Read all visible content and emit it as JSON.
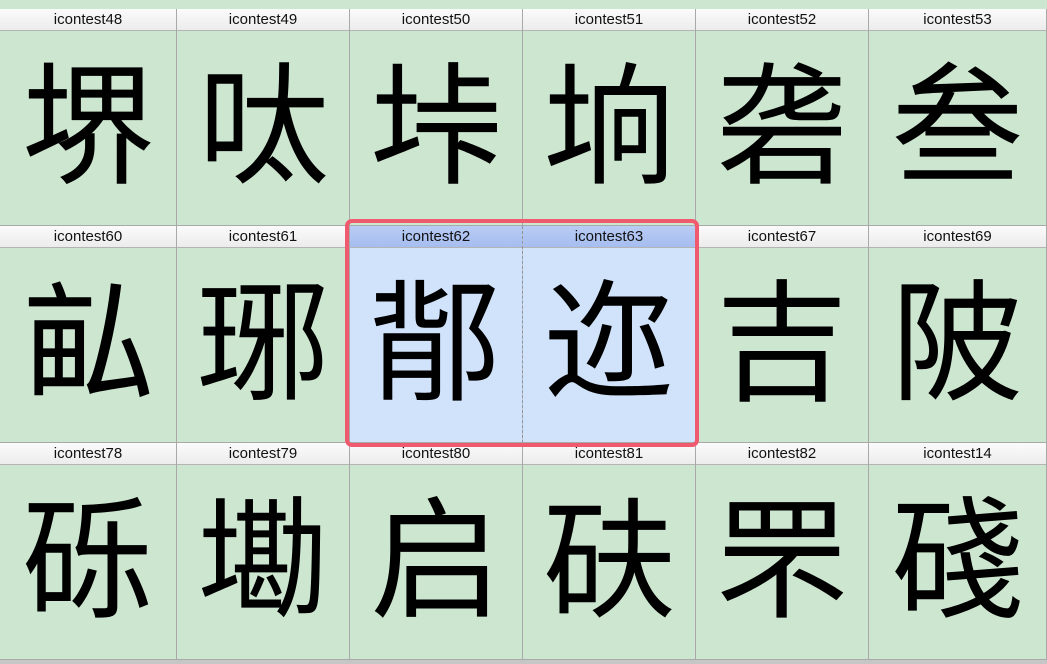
{
  "grid": {
    "rows": [
      {
        "cells": [
          {
            "label": "icontest48",
            "glyph": "堺"
          },
          {
            "label": "icontest49",
            "glyph": "呔"
          },
          {
            "label": "icontest50",
            "glyph": "垰"
          },
          {
            "label": "icontest51",
            "glyph": "垧"
          },
          {
            "label": "icontest52",
            "glyph": "砻"
          },
          {
            "label": "icontest53",
            "glyph": "叁"
          }
        ]
      },
      {
        "cells": [
          {
            "label": "icontest60",
            "glyph": "畆"
          },
          {
            "label": "icontest61",
            "glyph": "琊"
          },
          {
            "label": "icontest62",
            "glyph": "鄁",
            "selected": true
          },
          {
            "label": "icontest63",
            "glyph": "迩",
            "selected": true
          },
          {
            "label": "icontest67",
            "glyph": "吉"
          },
          {
            "label": "icontest69",
            "glyph": "陂"
          }
        ]
      },
      {
        "cells": [
          {
            "label": "icontest78",
            "glyph": "砾"
          },
          {
            "label": "icontest79",
            "glyph": "墈"
          },
          {
            "label": "icontest80",
            "glyph": "启"
          },
          {
            "label": "icontest81",
            "glyph": "砆"
          },
          {
            "label": "icontest82",
            "glyph": "罘"
          },
          {
            "label": "icontest14",
            "glyph": "碊"
          }
        ]
      }
    ]
  },
  "colors": {
    "cell_background": "#cde6cf",
    "selected_background": "#d1e3fb",
    "selection_outline": "#ef5a6e"
  }
}
